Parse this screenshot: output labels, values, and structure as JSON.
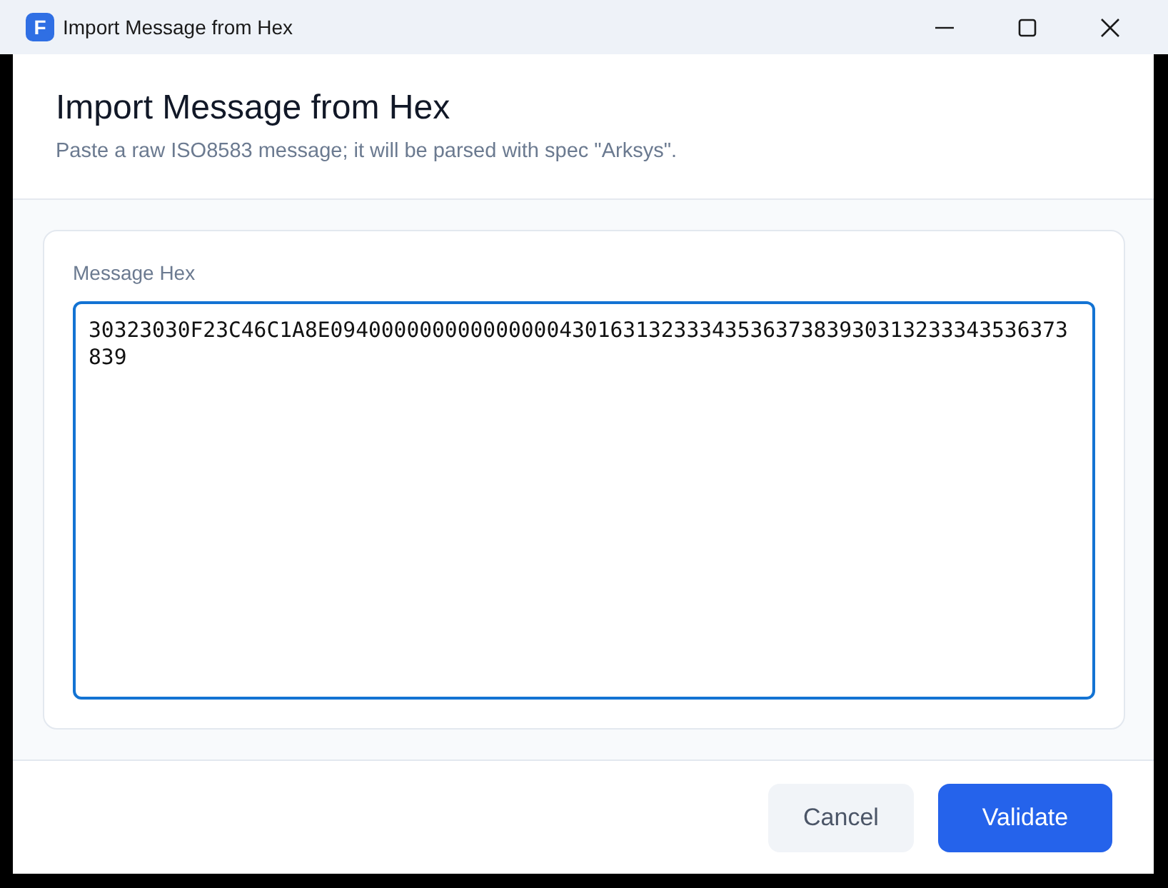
{
  "window": {
    "title": "Import Message from Hex",
    "icon_letter": "F"
  },
  "dialog": {
    "title": "Import Message from Hex",
    "subtitle": "Paste a raw ISO8583 message; it will be parsed with spec \"Arksys\"."
  },
  "message_hex": {
    "label": "Message Hex",
    "value": "30323030F23C46C1A8E0940000000000000004301631323334353637383930313233343536373839",
    "focused": true
  },
  "buttons": [
    {
      "label": "Cancel",
      "kind": "secondary"
    },
    {
      "label": "Validate",
      "kind": "primary"
    }
  ]
}
